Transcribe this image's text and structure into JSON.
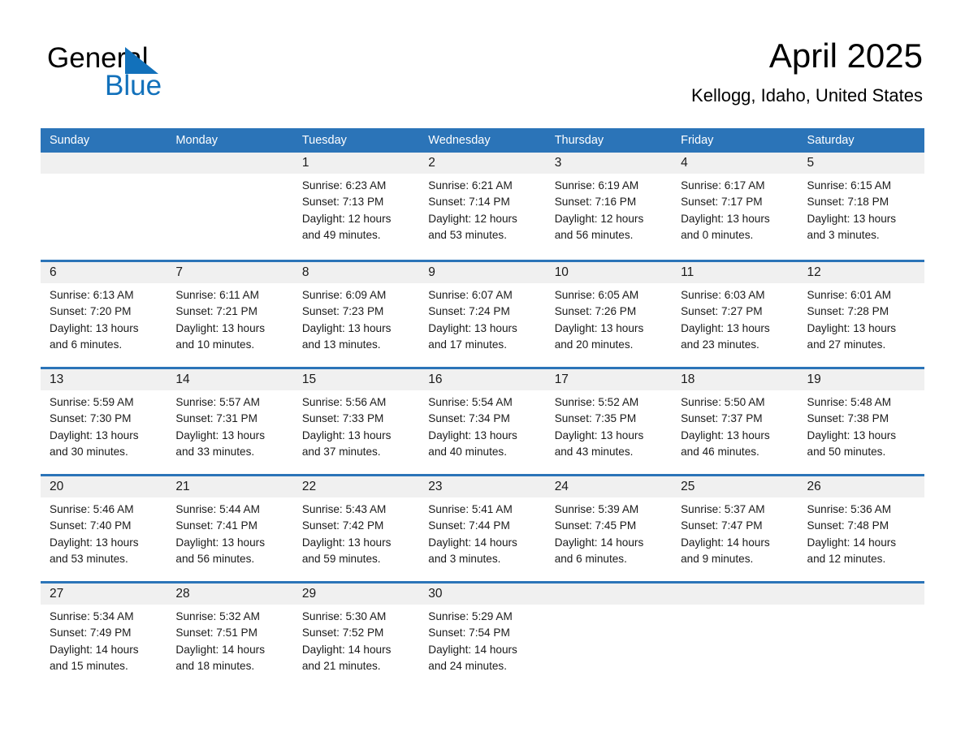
{
  "logo": {
    "word_one": "General",
    "word_two": "Blue",
    "triangle_color": "#1271bb",
    "text_color": "#000000"
  },
  "header": {
    "month_title": "April 2025",
    "location": "Kellogg, Idaho, United States"
  },
  "theme": {
    "header_blue": "#2b74b8",
    "day_band_gray": "#f0f0f0",
    "page_background": "#ffffff",
    "text_color": "#1a1a1a"
  },
  "weekdays": [
    "Sunday",
    "Monday",
    "Tuesday",
    "Wednesday",
    "Thursday",
    "Friday",
    "Saturday"
  ],
  "weeks": [
    {
      "days": [
        {
          "empty": true,
          "number": "",
          "sunrise": "",
          "sunset": "",
          "daylight_line1": "",
          "daylight_line2": ""
        },
        {
          "empty": true,
          "number": "",
          "sunrise": "",
          "sunset": "",
          "daylight_line1": "",
          "daylight_line2": ""
        },
        {
          "empty": false,
          "number": "1",
          "sunrise": "Sunrise: 6:23 AM",
          "sunset": "Sunset: 7:13 PM",
          "daylight_line1": "Daylight: 12 hours",
          "daylight_line2": "and 49 minutes."
        },
        {
          "empty": false,
          "number": "2",
          "sunrise": "Sunrise: 6:21 AM",
          "sunset": "Sunset: 7:14 PM",
          "daylight_line1": "Daylight: 12 hours",
          "daylight_line2": "and 53 minutes."
        },
        {
          "empty": false,
          "number": "3",
          "sunrise": "Sunrise: 6:19 AM",
          "sunset": "Sunset: 7:16 PM",
          "daylight_line1": "Daylight: 12 hours",
          "daylight_line2": "and 56 minutes."
        },
        {
          "empty": false,
          "number": "4",
          "sunrise": "Sunrise: 6:17 AM",
          "sunset": "Sunset: 7:17 PM",
          "daylight_line1": "Daylight: 13 hours",
          "daylight_line2": "and 0 minutes."
        },
        {
          "empty": false,
          "number": "5",
          "sunrise": "Sunrise: 6:15 AM",
          "sunset": "Sunset: 7:18 PM",
          "daylight_line1": "Daylight: 13 hours",
          "daylight_line2": "and 3 minutes."
        }
      ]
    },
    {
      "days": [
        {
          "empty": false,
          "number": "6",
          "sunrise": "Sunrise: 6:13 AM",
          "sunset": "Sunset: 7:20 PM",
          "daylight_line1": "Daylight: 13 hours",
          "daylight_line2": "and 6 minutes."
        },
        {
          "empty": false,
          "number": "7",
          "sunrise": "Sunrise: 6:11 AM",
          "sunset": "Sunset: 7:21 PM",
          "daylight_line1": "Daylight: 13 hours",
          "daylight_line2": "and 10 minutes."
        },
        {
          "empty": false,
          "number": "8",
          "sunrise": "Sunrise: 6:09 AM",
          "sunset": "Sunset: 7:23 PM",
          "daylight_line1": "Daylight: 13 hours",
          "daylight_line2": "and 13 minutes."
        },
        {
          "empty": false,
          "number": "9",
          "sunrise": "Sunrise: 6:07 AM",
          "sunset": "Sunset: 7:24 PM",
          "daylight_line1": "Daylight: 13 hours",
          "daylight_line2": "and 17 minutes."
        },
        {
          "empty": false,
          "number": "10",
          "sunrise": "Sunrise: 6:05 AM",
          "sunset": "Sunset: 7:26 PM",
          "daylight_line1": "Daylight: 13 hours",
          "daylight_line2": "and 20 minutes."
        },
        {
          "empty": false,
          "number": "11",
          "sunrise": "Sunrise: 6:03 AM",
          "sunset": "Sunset: 7:27 PM",
          "daylight_line1": "Daylight: 13 hours",
          "daylight_line2": "and 23 minutes."
        },
        {
          "empty": false,
          "number": "12",
          "sunrise": "Sunrise: 6:01 AM",
          "sunset": "Sunset: 7:28 PM",
          "daylight_line1": "Daylight: 13 hours",
          "daylight_line2": "and 27 minutes."
        }
      ]
    },
    {
      "days": [
        {
          "empty": false,
          "number": "13",
          "sunrise": "Sunrise: 5:59 AM",
          "sunset": "Sunset: 7:30 PM",
          "daylight_line1": "Daylight: 13 hours",
          "daylight_line2": "and 30 minutes."
        },
        {
          "empty": false,
          "number": "14",
          "sunrise": "Sunrise: 5:57 AM",
          "sunset": "Sunset: 7:31 PM",
          "daylight_line1": "Daylight: 13 hours",
          "daylight_line2": "and 33 minutes."
        },
        {
          "empty": false,
          "number": "15",
          "sunrise": "Sunrise: 5:56 AM",
          "sunset": "Sunset: 7:33 PM",
          "daylight_line1": "Daylight: 13 hours",
          "daylight_line2": "and 37 minutes."
        },
        {
          "empty": false,
          "number": "16",
          "sunrise": "Sunrise: 5:54 AM",
          "sunset": "Sunset: 7:34 PM",
          "daylight_line1": "Daylight: 13 hours",
          "daylight_line2": "and 40 minutes."
        },
        {
          "empty": false,
          "number": "17",
          "sunrise": "Sunrise: 5:52 AM",
          "sunset": "Sunset: 7:35 PM",
          "daylight_line1": "Daylight: 13 hours",
          "daylight_line2": "and 43 minutes."
        },
        {
          "empty": false,
          "number": "18",
          "sunrise": "Sunrise: 5:50 AM",
          "sunset": "Sunset: 7:37 PM",
          "daylight_line1": "Daylight: 13 hours",
          "daylight_line2": "and 46 minutes."
        },
        {
          "empty": false,
          "number": "19",
          "sunrise": "Sunrise: 5:48 AM",
          "sunset": "Sunset: 7:38 PM",
          "daylight_line1": "Daylight: 13 hours",
          "daylight_line2": "and 50 minutes."
        }
      ]
    },
    {
      "days": [
        {
          "empty": false,
          "number": "20",
          "sunrise": "Sunrise: 5:46 AM",
          "sunset": "Sunset: 7:40 PM",
          "daylight_line1": "Daylight: 13 hours",
          "daylight_line2": "and 53 minutes."
        },
        {
          "empty": false,
          "number": "21",
          "sunrise": "Sunrise: 5:44 AM",
          "sunset": "Sunset: 7:41 PM",
          "daylight_line1": "Daylight: 13 hours",
          "daylight_line2": "and 56 minutes."
        },
        {
          "empty": false,
          "number": "22",
          "sunrise": "Sunrise: 5:43 AM",
          "sunset": "Sunset: 7:42 PM",
          "daylight_line1": "Daylight: 13 hours",
          "daylight_line2": "and 59 minutes."
        },
        {
          "empty": false,
          "number": "23",
          "sunrise": "Sunrise: 5:41 AM",
          "sunset": "Sunset: 7:44 PM",
          "daylight_line1": "Daylight: 14 hours",
          "daylight_line2": "and 3 minutes."
        },
        {
          "empty": false,
          "number": "24",
          "sunrise": "Sunrise: 5:39 AM",
          "sunset": "Sunset: 7:45 PM",
          "daylight_line1": "Daylight: 14 hours",
          "daylight_line2": "and 6 minutes."
        },
        {
          "empty": false,
          "number": "25",
          "sunrise": "Sunrise: 5:37 AM",
          "sunset": "Sunset: 7:47 PM",
          "daylight_line1": "Daylight: 14 hours",
          "daylight_line2": "and 9 minutes."
        },
        {
          "empty": false,
          "number": "26",
          "sunrise": "Sunrise: 5:36 AM",
          "sunset": "Sunset: 7:48 PM",
          "daylight_line1": "Daylight: 14 hours",
          "daylight_line2": "and 12 minutes."
        }
      ]
    },
    {
      "days": [
        {
          "empty": false,
          "number": "27",
          "sunrise": "Sunrise: 5:34 AM",
          "sunset": "Sunset: 7:49 PM",
          "daylight_line1": "Daylight: 14 hours",
          "daylight_line2": "and 15 minutes."
        },
        {
          "empty": false,
          "number": "28",
          "sunrise": "Sunrise: 5:32 AM",
          "sunset": "Sunset: 7:51 PM",
          "daylight_line1": "Daylight: 14 hours",
          "daylight_line2": "and 18 minutes."
        },
        {
          "empty": false,
          "number": "29",
          "sunrise": "Sunrise: 5:30 AM",
          "sunset": "Sunset: 7:52 PM",
          "daylight_line1": "Daylight: 14 hours",
          "daylight_line2": "and 21 minutes."
        },
        {
          "empty": false,
          "number": "30",
          "sunrise": "Sunrise: 5:29 AM",
          "sunset": "Sunset: 7:54 PM",
          "daylight_line1": "Daylight: 14 hours",
          "daylight_line2": "and 24 minutes."
        },
        {
          "empty": true,
          "number": "",
          "sunrise": "",
          "sunset": "",
          "daylight_line1": "",
          "daylight_line2": ""
        },
        {
          "empty": true,
          "number": "",
          "sunrise": "",
          "sunset": "",
          "daylight_line1": "",
          "daylight_line2": ""
        },
        {
          "empty": true,
          "number": "",
          "sunrise": "",
          "sunset": "",
          "daylight_line1": "",
          "daylight_line2": ""
        }
      ]
    }
  ]
}
